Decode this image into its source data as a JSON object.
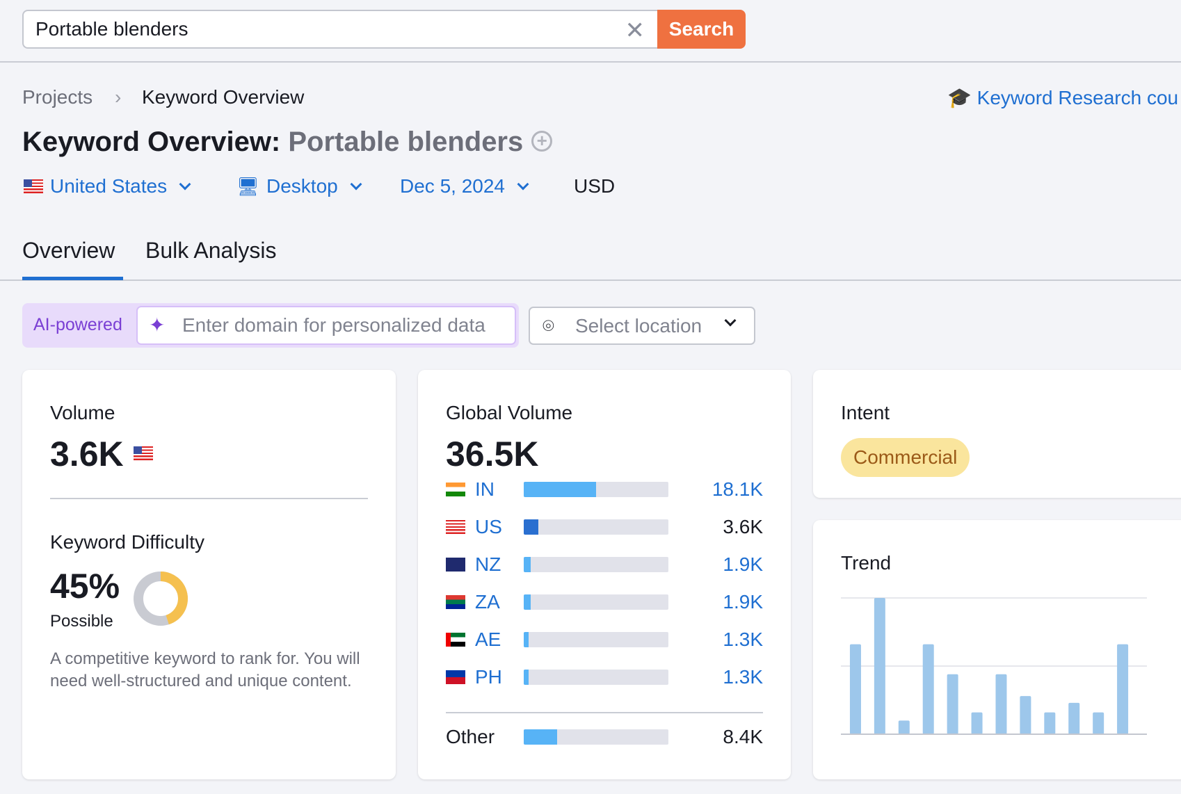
{
  "search": {
    "value": "Portable blenders",
    "button": "Search"
  },
  "breadcrumb": {
    "items": [
      "Projects",
      "Keyword Overview"
    ]
  },
  "course_link": "Keyword Research cou",
  "title": {
    "prefix": "Keyword Overview:",
    "keyword": "Portable blenders"
  },
  "filters": {
    "country": "United States",
    "device": "Desktop",
    "date": "Dec 5, 2024",
    "currency": "USD"
  },
  "tabs": [
    {
      "label": "Overview",
      "active": true
    },
    {
      "label": "Bulk Analysis",
      "active": false
    }
  ],
  "ai": {
    "label": "AI-powered",
    "placeholder": "Enter domain for personalized data",
    "location_placeholder": "Select location"
  },
  "volume": {
    "label": "Volume",
    "value": "3.6K"
  },
  "difficulty": {
    "label": "Keyword Difficulty",
    "value": "45%",
    "level": "Possible",
    "percent": 45,
    "description": "A competitive keyword to rank for. You will need well-structured and unique content.",
    "color": "#f5c04f"
  },
  "global": {
    "label": "Global Volume",
    "value": "36.5K",
    "rows": [
      {
        "code": "IN",
        "value": "18.1K",
        "fill": 0.5,
        "link": true
      },
      {
        "code": "US",
        "value": "3.6K",
        "fill": 0.1,
        "link": false
      },
      {
        "code": "NZ",
        "value": "1.9K",
        "fill": 0.05,
        "link": true
      },
      {
        "code": "ZA",
        "value": "1.9K",
        "fill": 0.05,
        "link": true
      },
      {
        "code": "AE",
        "value": "1.3K",
        "fill": 0.035,
        "link": true
      },
      {
        "code": "PH",
        "value": "1.3K",
        "fill": 0.035,
        "link": true
      }
    ],
    "other": {
      "label": "Other",
      "value": "8.4K",
      "fill": 0.23
    }
  },
  "intent": {
    "label": "Intent",
    "value": "Commercial"
  },
  "chart_data": {
    "type": "bar",
    "title": "Trend",
    "values": [
      0.66,
      1.0,
      0.1,
      0.66,
      0.44,
      0.16,
      0.44,
      0.28,
      0.16,
      0.23,
      0.16,
      0.66
    ],
    "ylim": [
      0,
      1
    ],
    "grid": true,
    "color": "#9dc7eb"
  }
}
